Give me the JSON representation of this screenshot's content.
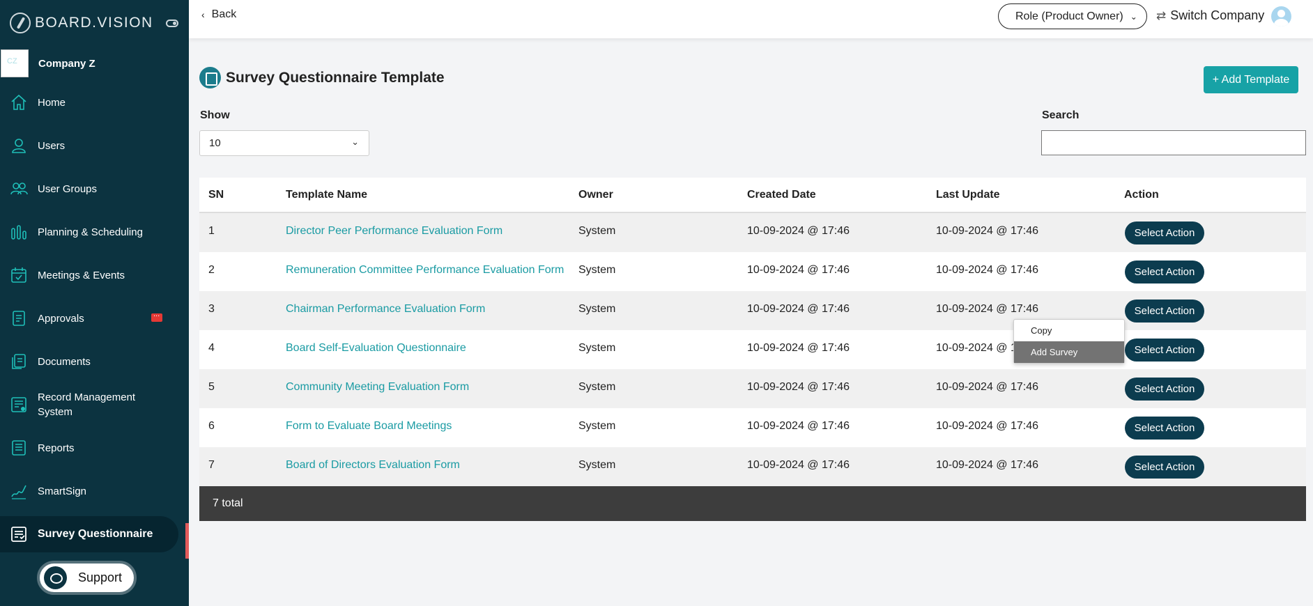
{
  "sidebar": {
    "brand": "BOARD.VISION",
    "company": "Company Z",
    "items": [
      {
        "label": "Home",
        "icon": "home-icon"
      },
      {
        "label": "Users",
        "icon": "user-icon"
      },
      {
        "label": "User Groups",
        "icon": "users-icon"
      },
      {
        "label": "Planning & Scheduling",
        "icon": "chart-icon"
      },
      {
        "label": "Meetings & Events",
        "icon": "calendar-icon"
      },
      {
        "label": "Approvals",
        "icon": "document-icon"
      },
      {
        "label": "Documents",
        "icon": "documents-icon"
      },
      {
        "label": "Record Management System",
        "icon": "record-icon"
      },
      {
        "label": "Reports",
        "icon": "list-icon"
      },
      {
        "label": "SmartSign",
        "icon": "signature-icon"
      },
      {
        "label": "Survey Questionnaire",
        "icon": "survey-icon"
      }
    ],
    "support_label": "Support"
  },
  "topbar": {
    "back_label": "Back",
    "role_label": "Role (Product Owner)",
    "switch_label": "Switch Company"
  },
  "page": {
    "title": "Survey Questionnaire Template",
    "add_button": "+ Add Template",
    "show_label": "Show",
    "show_value": "10",
    "search_label": "Search",
    "search_value": ""
  },
  "table": {
    "headers": [
      "SN",
      "Template Name",
      "Owner",
      "Created Date",
      "Last Update",
      "Action"
    ],
    "rows": [
      {
        "sn": "1",
        "name": "Director Peer Performance Evaluation Form",
        "owner": "System",
        "created": "10-09-2024 @ 17:46",
        "updated": "10-09-2024 @ 17:46"
      },
      {
        "sn": "2",
        "name": "Remuneration Committee Performance Evaluation Form",
        "owner": "System",
        "created": "10-09-2024 @ 17:46",
        "updated": "10-09-2024 @ 17:46"
      },
      {
        "sn": "3",
        "name": "Chairman Performance Evaluation Form",
        "owner": "System",
        "created": "10-09-2024 @ 17:46",
        "updated": "10-09-2024 @ 17:46"
      },
      {
        "sn": "4",
        "name": "Board Self-Evaluation Questionnaire",
        "owner": "System",
        "created": "10-09-2024 @ 17:46",
        "updated": "10-09-2024 @ 17:46"
      },
      {
        "sn": "5",
        "name": "Community Meeting Evaluation Form",
        "owner": "System",
        "created": "10-09-2024 @ 17:46",
        "updated": "10-09-2024 @ 17:46"
      },
      {
        "sn": "6",
        "name": "Form to Evaluate Board Meetings",
        "owner": "System",
        "created": "10-09-2024 @ 17:46",
        "updated": "10-09-2024 @ 17:46"
      },
      {
        "sn": "7",
        "name": "Board of Directors Evaluation Form",
        "owner": "System",
        "created": "10-09-2024 @ 17:46",
        "updated": "10-09-2024 @ 17:46"
      }
    ],
    "action_label": "Select Action",
    "footer": "7 total"
  },
  "dropdown": {
    "items": [
      "Copy",
      "Add Survey"
    ]
  },
  "colors": {
    "sidebar_bg": "#0c3340",
    "accent": "#17a2a6",
    "action_button": "#0c3c4f",
    "footer_bg": "#3d3d3d",
    "active_marker": "#e35b5b"
  }
}
